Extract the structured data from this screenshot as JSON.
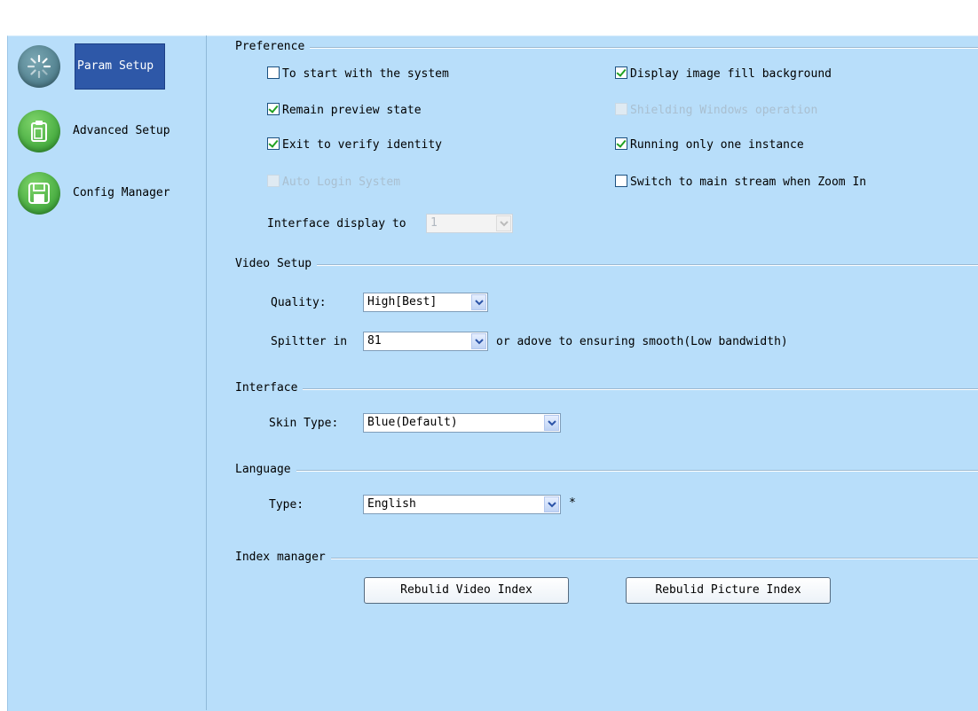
{
  "sidebar": {
    "items": [
      {
        "label": "Param Setup",
        "active": true,
        "icon": "spinner-icon"
      },
      {
        "label": "Advanced Setup",
        "active": false,
        "icon": "clipboard-icon"
      },
      {
        "label": "Config Manager",
        "active": false,
        "icon": "floppy-disk-icon"
      }
    ]
  },
  "preference": {
    "legend": "Preference",
    "options": [
      {
        "label": "To start with the system",
        "checked": false,
        "enabled": true
      },
      {
        "label": "Display image fill background",
        "checked": true,
        "enabled": true
      },
      {
        "label": "Remain preview state",
        "checked": true,
        "enabled": true
      },
      {
        "label": "Shielding Windows operation",
        "checked": false,
        "enabled": false
      },
      {
        "label": "Exit to verify identity",
        "checked": true,
        "enabled": true
      },
      {
        "label": "Running only one instance",
        "checked": true,
        "enabled": true
      },
      {
        "label": "Auto Login System",
        "checked": false,
        "enabled": false
      },
      {
        "label": "Switch to main stream when Zoom In",
        "checked": false,
        "enabled": true
      }
    ],
    "interface_display_label": "Interface display to",
    "interface_display_value": "1"
  },
  "video_setup": {
    "legend": "Video Setup",
    "quality_label": "Quality:",
    "quality_value": "High[Best]",
    "splitter_label": "Spiltter in",
    "splitter_value": "81",
    "splitter_suffix": "or adove to ensuring smooth(Low bandwidth)"
  },
  "interface": {
    "legend": "Interface",
    "skin_label": "Skin Type:",
    "skin_value": "Blue(Default)"
  },
  "language": {
    "legend": "Language",
    "type_label": "Type:",
    "type_value": "English",
    "required_mark": "*"
  },
  "index_manager": {
    "legend": "Index manager",
    "rebuild_video_label": "Rebulid Video Index",
    "rebuild_picture_label": "Rebulid Picture Index"
  },
  "colors": {
    "panel_bg": "#b8defa",
    "active_nav": "#2e58a8",
    "icon_green": "#3aa83a",
    "check_green": "#21a121"
  }
}
